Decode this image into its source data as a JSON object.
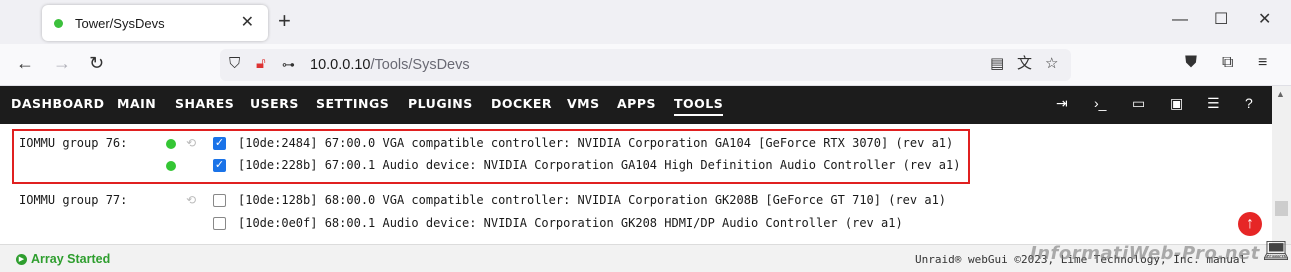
{
  "browser": {
    "tab_title": "Tower/SysDevs",
    "url_host": "10.0.0.10",
    "url_path": "/Tools/SysDevs"
  },
  "menu": {
    "items": [
      "DASHBOARD",
      "MAIN",
      "SHARES",
      "USERS",
      "SETTINGS",
      "PLUGINS",
      "DOCKER",
      "VMS",
      "APPS",
      "TOOLS"
    ],
    "active": "TOOLS"
  },
  "iommu_groups": [
    {
      "label": "IOMMU group 76:",
      "devices": [
        {
          "text": "[10de:2484] 67:00.0 VGA compatible controller: NVIDIA Corporation GA104 [GeForce RTX 3070] (rev a1)",
          "checked": true,
          "bound": true
        },
        {
          "text": "[10de:228b] 67:00.1 Audio device: NVIDIA Corporation GA104 High Definition Audio Controller (rev a1)",
          "checked": true,
          "bound": true
        }
      ]
    },
    {
      "label": "IOMMU group 77:",
      "devices": [
        {
          "text": "[10de:128b] 68:00.0 VGA compatible controller: NVIDIA Corporation GK208B [GeForce GT 710] (rev a1)",
          "checked": false,
          "bound": false
        },
        {
          "text": "[10de:0e0f] 68:00.1 Audio device: NVIDIA Corporation GK208 HDMI/DP Audio Controller (rev a1)",
          "checked": false,
          "bound": false
        }
      ]
    }
  ],
  "footer": {
    "array_status": "Array Started",
    "copyright": "Unraid® webGui ©2023, Lime Technology, Inc. manual"
  },
  "watermark": "InformatiWeb-Pro.net",
  "colors": {
    "menu_bg": "#1c1c1c",
    "status_green": "#2e9e2e",
    "highlight_red": "#e02020",
    "checkbox_blue": "#1a73e8"
  }
}
